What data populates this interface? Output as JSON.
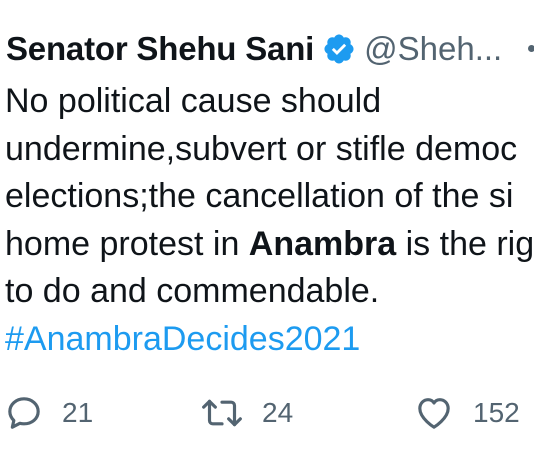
{
  "tweet": {
    "display_name": "Senator Shehu Sani",
    "verified_icon": "verified-badge-icon",
    "handle": "@Sheh...",
    "more_icon": "more-options-icon",
    "body": {
      "line1": "No political cause should",
      "line2": "undermine,subvert or stifle democ",
      "line3": "elections;the cancellation of the si",
      "line4_before": "home protest in ",
      "line4_bold": "Anambra",
      "line4_after": " is the rig",
      "line5": "to do and commendable.",
      "hashtag": "#AnambraDecides2021"
    },
    "actions": {
      "reply_icon": "reply-icon",
      "reply_count": "21",
      "retweet_icon": "retweet-icon",
      "retweet_count": "24",
      "like_icon": "heart-icon",
      "like_count": "152"
    }
  },
  "colors": {
    "text": "#0f1419",
    "secondary": "#536471",
    "accent": "#1d9bf0"
  }
}
